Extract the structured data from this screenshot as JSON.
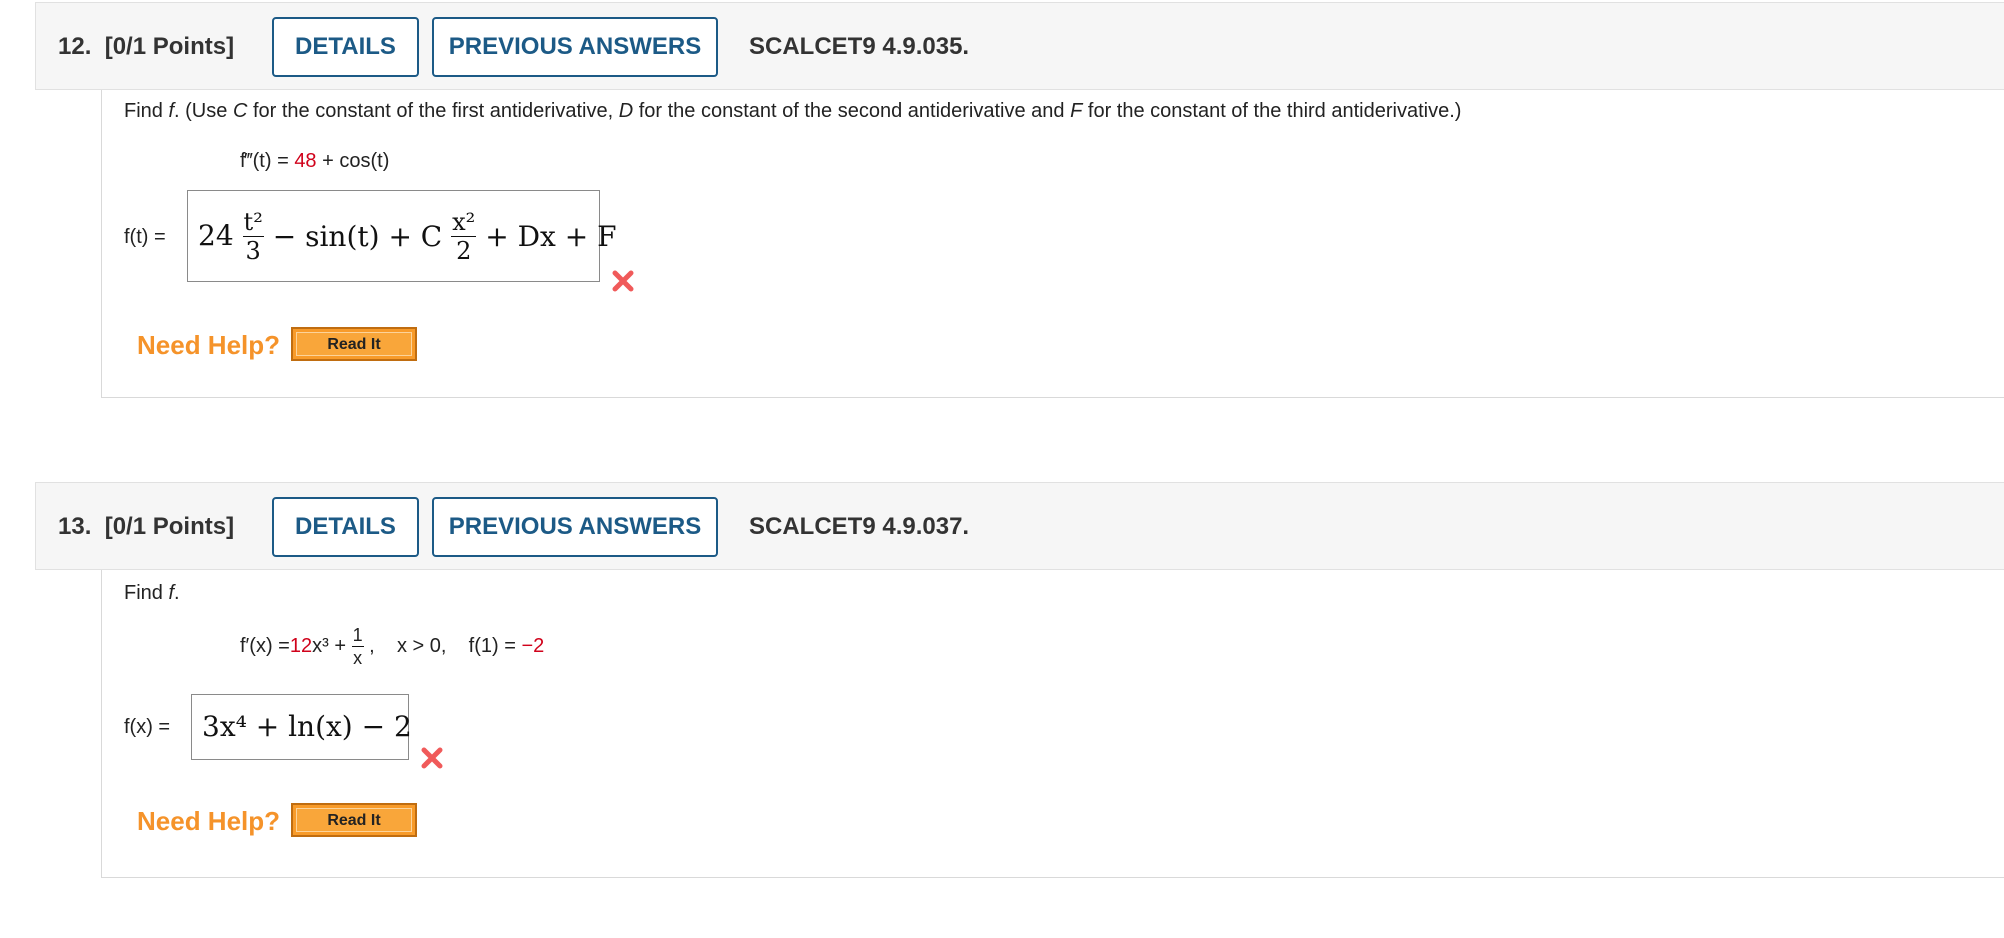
{
  "questions": [
    {
      "number": "12.",
      "points": "[0/1 Points]",
      "details_label": "DETAILS",
      "previous_answers_label": "PREVIOUS ANSWERS",
      "code": "SCALCET9 4.9.035.",
      "prompt": {
        "pre": "Find ",
        "var": "f",
        "mid1": ". (Use ",
        "c": "C",
        "mid2": " for the constant of the first antiderivative, ",
        "d": "D",
        "mid3": " for the constant of the second antiderivative and ",
        "f2": "F",
        "post": " for the constant of the third antiderivative.)"
      },
      "given": {
        "lhs": "f‴(t) = ",
        "coef": "48",
        "rest": " + cos(t)"
      },
      "answer_label": "f(t) =",
      "answer": {
        "t1_coef": "24",
        "t1_num": "t²",
        "t1_den": "3",
        "t2": " − sin(t) + C",
        "t3_num": "x²",
        "t3_den": "2",
        "t4": " + Dx + F"
      },
      "status_icon": "wrong-x-icon",
      "need_help_label": "Need Help?",
      "read_it_label": "Read It"
    },
    {
      "number": "13.",
      "points": "[0/1 Points]",
      "details_label": "DETAILS",
      "previous_answers_label": "PREVIOUS ANSWERS",
      "code": "SCALCET9 4.9.037.",
      "prompt": {
        "pre": "Find ",
        "var": "f",
        "post": "."
      },
      "given": {
        "lhs": "f′(x) = ",
        "coef": "12",
        "pow": "x³ + ",
        "frac_num": "1",
        "frac_den": "x",
        "cond": ",    x > 0,    f(1) = ",
        "init_val": "−2"
      },
      "answer_label": "f(x) =",
      "answer": "3x⁴ + ln(x) − 2",
      "status_icon": "wrong-x-icon",
      "need_help_label": "Need Help?",
      "read_it_label": "Read It"
    }
  ],
  "colors": {
    "header_bg": "#f6f6f6",
    "button_border": "#1c5a86",
    "given_value": "#d0021b",
    "wrong_mark": "#f05a5a",
    "need_help": "#f5932a",
    "read_it_bg": "#f89b2a"
  }
}
